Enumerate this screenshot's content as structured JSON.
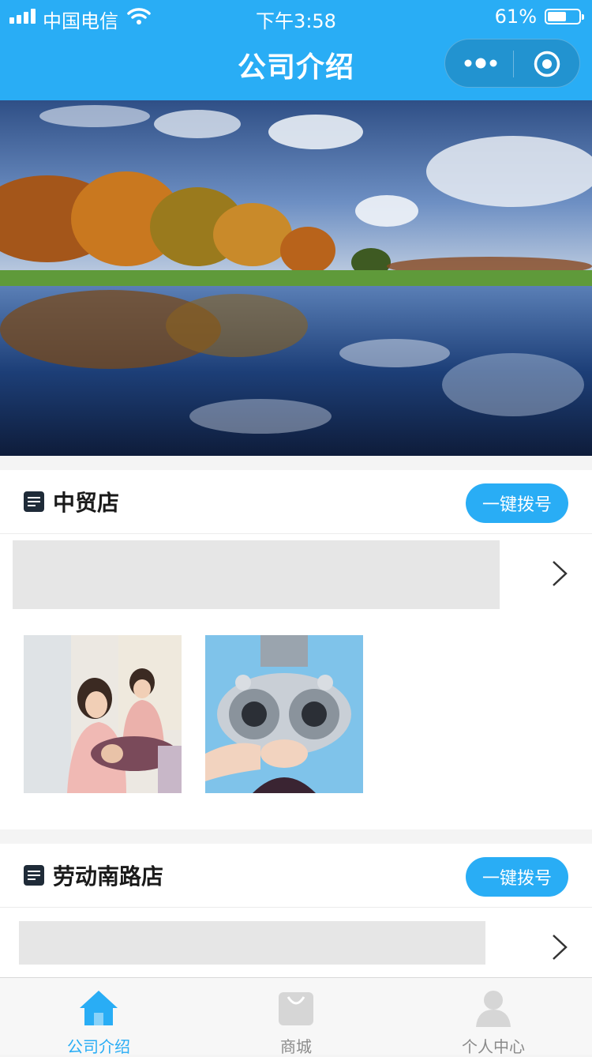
{
  "status_bar": {
    "carrier": "中国电信",
    "time": "下午3:58",
    "battery": "61%",
    "battery_level": 0.61
  },
  "nav": {
    "title": "公司介绍",
    "capsule_icons": [
      "more-dots-icon",
      "target-circle-icon"
    ]
  },
  "banner": {
    "icon": "landscape-image",
    "colors": {
      "sky": "#4f78b4",
      "water": "#1d3f78",
      "foliage": "#c9781f"
    }
  },
  "stores": [
    {
      "name": "中贸店",
      "call_label": "一键拨号",
      "photos": [
        "beauty-salon-photo",
        "eye-exam-photo"
      ]
    },
    {
      "name": "劳动南路店",
      "call_label": "一键拨号"
    }
  ],
  "tabs": [
    {
      "label": "公司介绍",
      "icon": "home-icon",
      "active": true
    },
    {
      "label": "商城",
      "icon": "shopping-bag-icon",
      "active": false
    },
    {
      "label": "个人中心",
      "icon": "person-icon",
      "active": false
    }
  ],
  "colors": {
    "accent": "#29adf5",
    "inactive": "#8a8a8a",
    "placeholder": "#e6e6e6"
  }
}
